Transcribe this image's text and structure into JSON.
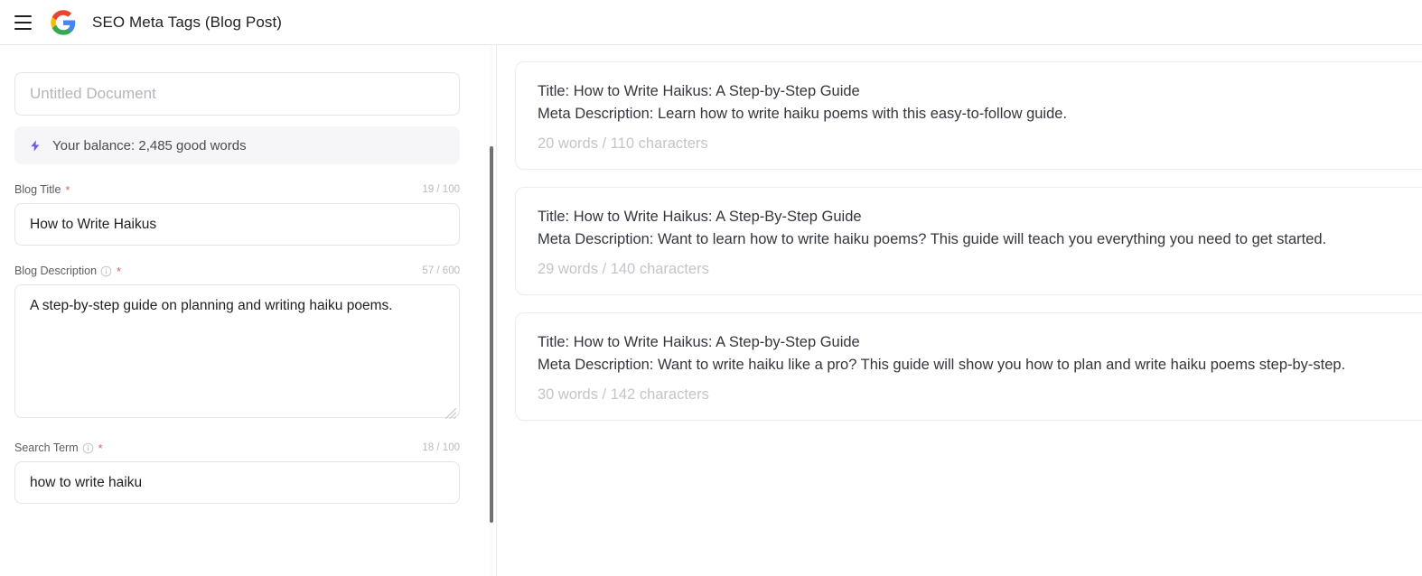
{
  "header": {
    "menu_icon": "hamburger-menu-icon",
    "logo_icon": "google-logo-icon",
    "title": "SEO Meta Tags (Blog Post)"
  },
  "sidebar": {
    "document_title": {
      "value": "",
      "placeholder": "Untitled Document"
    },
    "balance": {
      "icon": "lightning-bolt-icon",
      "text": "Your balance: 2,485 good words",
      "accent_color": "#6c5ce7",
      "background_color": "#f6f6f9"
    },
    "fields": [
      {
        "label": "Blog Title",
        "required_marker": "*",
        "has_info_icon": false,
        "counter": "19 / 100",
        "value": "How to Write Haikus",
        "placeholder": "",
        "type": "input"
      },
      {
        "label": "Blog Description",
        "required_marker": "*",
        "has_info_icon": true,
        "counter": "57 / 600",
        "value": "A step-by-step guide on planning and writing haiku poems.",
        "placeholder": "",
        "type": "textarea"
      },
      {
        "label": "Search Term",
        "required_marker": "*",
        "has_info_icon": true,
        "counter": "18 / 100",
        "value": "how to write haiku",
        "placeholder": "",
        "type": "input"
      }
    ],
    "required_marker_color": "#e05c5c"
  },
  "results": {
    "cards": [
      {
        "title_line": "Title: How to Write Haikus: A Step-by-Step Guide",
        "description_line": "Meta Description: Learn how to write haiku poems with this easy-to-follow guide.",
        "stats": "20 words / 110 characters"
      },
      {
        "title_line": "Title: How to Write Haikus: A Step-By-Step Guide",
        "description_line": "Meta Description: Want to learn how to write haiku poems? This guide will teach you everything you need to get started.",
        "stats": "29 words / 140 characters"
      },
      {
        "title_line": "Title: How to Write Haikus: A Step-by-Step Guide",
        "description_line": "Meta Description: Want to write haiku like a pro? This guide will show you how to plan and write haiku poems step-by-step.",
        "stats": "30 words / 142 characters"
      }
    ]
  },
  "scrollbar": {
    "name": "left-pane-scrollbar"
  }
}
